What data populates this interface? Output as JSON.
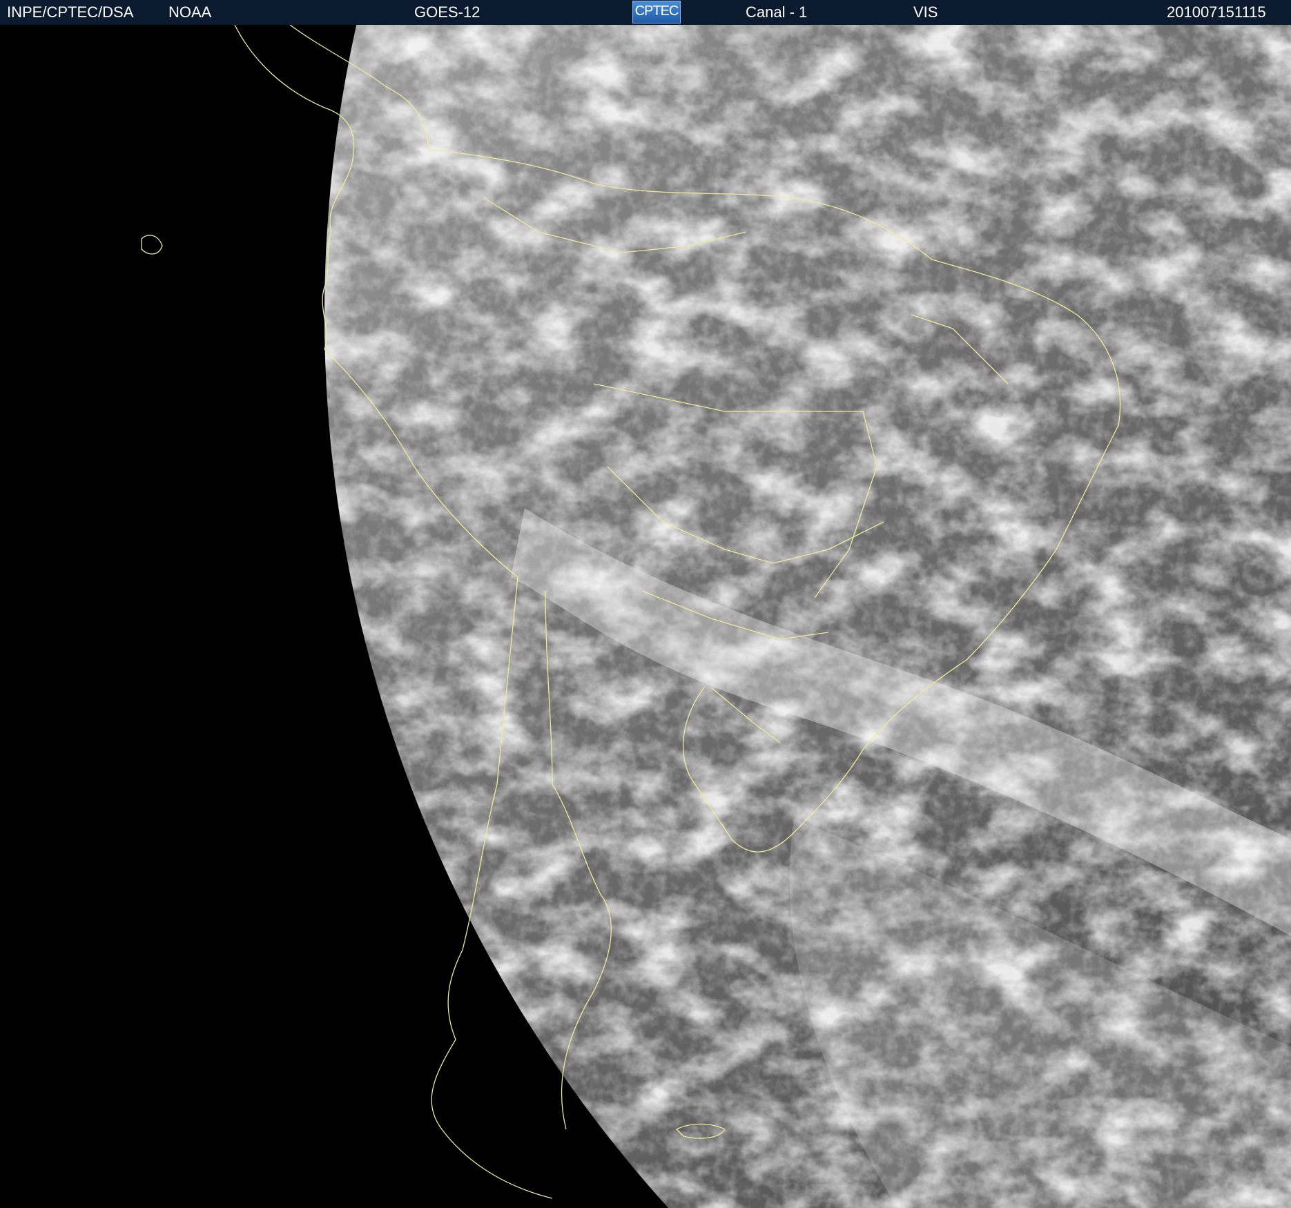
{
  "header": {
    "agency": "INPE/CPTEC/DSA",
    "source": "NOAA",
    "satellite": "GOES-12",
    "logo_text": "CPTEC",
    "channel": "Canal - 1",
    "band": "VIS",
    "timestamp": "201007151115"
  },
  "colors": {
    "header_bg": "#0b1a2e",
    "space": "#000000",
    "earth": "#5a5a5a",
    "clouds": "#e6e6e6",
    "coastline": "#ecec9c"
  }
}
